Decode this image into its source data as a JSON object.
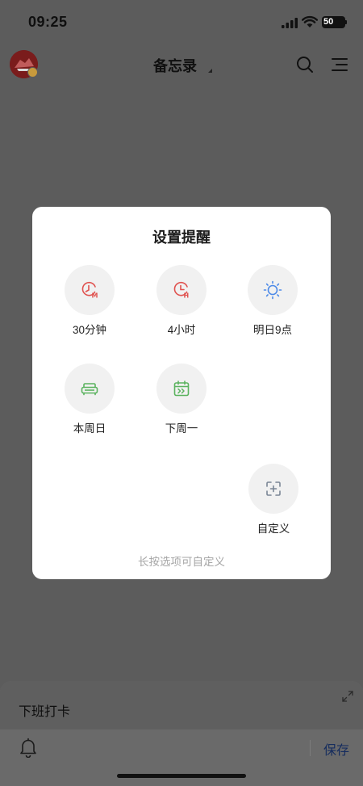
{
  "status_bar": {
    "time": "09:25",
    "battery": "50",
    "icons": [
      "signal-icon",
      "wifi-icon",
      "battery-icon"
    ]
  },
  "header": {
    "title": "备忘录",
    "icons": [
      "avatar",
      "search-icon",
      "menu-icon"
    ]
  },
  "dialog": {
    "title": "设置提醒",
    "options": [
      {
        "label": "30分钟",
        "icon": "clock-m-icon",
        "color": "#e0524f"
      },
      {
        "label": "4小时",
        "icon": "clock-h-icon",
        "color": "#e0524f"
      },
      {
        "label": "明日9点",
        "icon": "sun-icon",
        "color": "#4d8ae8"
      },
      {
        "label": "本周日",
        "icon": "sofa-icon",
        "color": "#5bb35f"
      },
      {
        "label": "下周一",
        "icon": "calendar-next-icon",
        "color": "#5bb35f"
      },
      {
        "label": "自定义",
        "icon": "custom-add-icon",
        "color": "#7a8696"
      }
    ],
    "hint": "长按选项可自定义"
  },
  "bottom_sheet": {
    "note_text": "下班打卡",
    "save_label": "保存",
    "icons": [
      "expand-icon",
      "bell-icon"
    ]
  }
}
